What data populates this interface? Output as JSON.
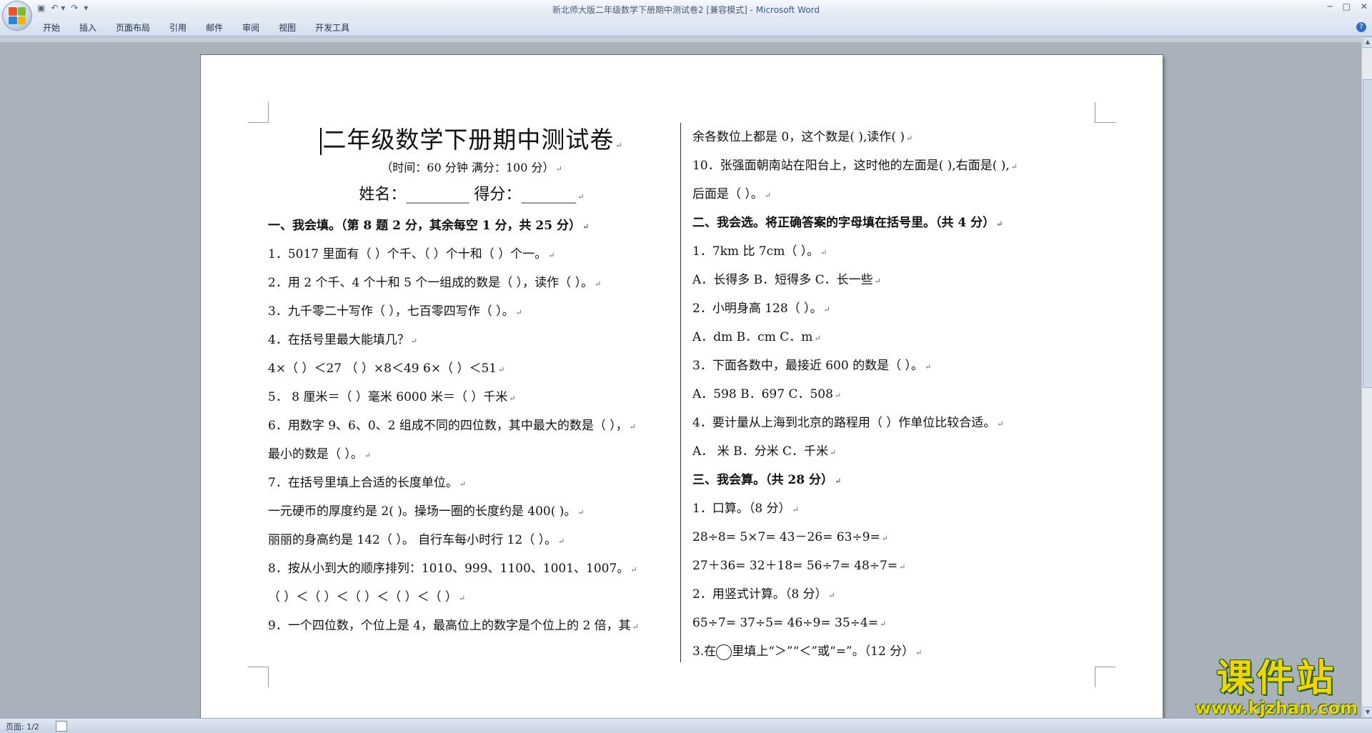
{
  "window": {
    "title": "新北师大版二年级数学下册期中测试卷2 [兼容模式] - ",
    "app": "Microsoft Word",
    "controls": [
      "─",
      "□",
      "✕"
    ]
  },
  "qat": {
    "save": "▣",
    "undo": "↶ ▾",
    "redo": "↷",
    "more": "▾"
  },
  "tabs": [
    "开始",
    "插入",
    "页面布局",
    "引用",
    "邮件",
    "审阅",
    "视图",
    "开发工具"
  ],
  "help": "?",
  "doc": {
    "title": "二年级数学下册期中测试卷",
    "subtitle": "（时间：60 分钟      满分：100 分）",
    "name_line": "姓名：________    得分：_______",
    "left": [
      {
        "t": "一、我会填。（第 8 题 2 分，其余每空 1 分，共 25 分）",
        "bold": true
      },
      {
        "t": "1．5017 里面有（      ）个千、（      ）个十和（      ）个一。"
      },
      {
        "t": "2．用 2 个千、4 个十和 5 个一组成的数是（      ），读作（           ）。"
      },
      {
        "t": "3．九千零二十写作（            ），七百零四写作（            ）。"
      },
      {
        "t": "4．在括号里最大能填几？"
      },
      {
        "t": "   4×（      ）＜27    （      ）×8＜49    6×（      ）＜51"
      },
      {
        "t": "5． 8 厘米＝（        ）毫米          6000 米＝（      ）千米"
      },
      {
        "t": "6．用数字 9、6、0、2 组成不同的四位数，其中最大的数是（        ），"
      },
      {
        "t": "最小的数是（       ）。"
      },
      {
        "t": "7．在括号里填上合适的长度单位。"
      },
      {
        "t": "一元硬币的厚度约是 2(         )。操场一圈的长度约是 400(         )。"
      },
      {
        "t": "丽丽的身高约是 142（        ）。   自行车每小时行 12（             ）。"
      },
      {
        "t": "8．按从小到大的顺序排列：1010、999、1100、1001、1007。"
      },
      {
        "t": " （         ）＜（          ）＜（          ）＜（          ）＜（          ）"
      },
      {
        "t": "9．一个四位数，个位上是 4，最高位上的数字是个位上的 2 倍，其"
      }
    ],
    "right": [
      {
        "t": "余各数位上都是 0，这个数是(        ),读作(                         )"
      },
      {
        "t": "10．张强面朝南站在阳台上，这时他的左面是(        ),右面是(        ),"
      },
      {
        "t": "后面是（        ）。"
      },
      {
        "t": "二、我会选。将正确答案的字母填在括号里。（共 4 分）",
        "bold": true
      },
      {
        "t": "1．7km 比 7cm（          ）。"
      },
      {
        "t": "A．长得多            B．短得多        C．长一些"
      },
      {
        "t": "2．小明身高 128（          ）。"
      },
      {
        "t": " A．dm                B．cm            C．m"
      },
      {
        "t": "3．下面各数中，最接近 600 的数是（            ）。"
      },
      {
        "t": " A．598               B．697           C．508"
      },
      {
        "t": "4．要计量从上海到北京的路程用（          ）作单位比较合适。"
      },
      {
        "t": " A．   米           B．分米          C．千米"
      },
      {
        "t": "三、我会算。（共 28 分）",
        "bold": true
      },
      {
        "t": "1．口算。（8 分）"
      },
      {
        "t": "28÷8=               5×7=              43－26=              63÷9="
      },
      {
        "t": "27＋36=            32＋18=             56÷7=                48÷7="
      },
      {
        "t": "2．用竖式计算。（8 分）"
      },
      {
        "t": "65÷7=               37÷5=              46÷9=                35÷4="
      }
    ],
    "last_right_pre": "3.在",
    "last_right_post": "里填上“＞”“＜”或“=”。（12 分）"
  },
  "status": {
    "page": "页面: 1/2"
  },
  "watermark": {
    "big": "课件站",
    "url": "www.kjzhan.com"
  },
  "colors": {
    "brand_blue": "#2f5da8",
    "watermark_yellow": "#f1d400",
    "watermark_outline": "#1a5c16"
  }
}
